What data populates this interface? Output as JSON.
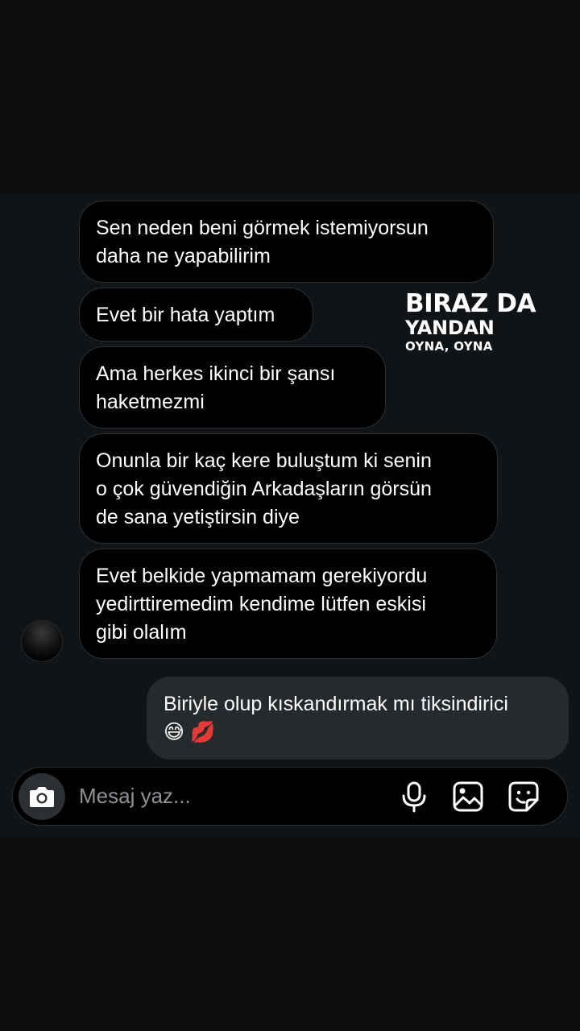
{
  "overlay": {
    "line1": "BIRAZ DA",
    "line2": "YANDAN",
    "line3": "OYNA, OYNA"
  },
  "messages": [
    {
      "side": "received",
      "text": "Sen neden beni görmek istemiyorsun\ndaha ne yapabilirim"
    },
    {
      "side": "received",
      "text": "Evet bir hata yaptım"
    },
    {
      "side": "received",
      "text": "Ama herkes ikinci bir şansı\nhaketmezmi"
    },
    {
      "side": "received",
      "text": "Onunla bir kaç kere buluştum ki senin\no çok güvendiğin Arkadaşların görsün\nde sana yetiştirsin diye"
    },
    {
      "side": "received",
      "text": "Evet belkide yapmamam gerekiyordu\nyedirttiremedim kendime lütfen eskisi\ngibi olalım"
    },
    {
      "side": "sent",
      "text": "Biriyle olup kıskandırmak mı tiksindirici\n😅 💋"
    }
  ],
  "composer": {
    "placeholder": "Mesaj yaz...",
    "icons": [
      "camera-icon",
      "microphone-icon",
      "gallery-icon",
      "sticker-icon"
    ]
  },
  "colors": {
    "chat_background": "#101416",
    "received_bubble": "#000000",
    "sent_bubble": "#262a2d",
    "text": "#ffffff"
  }
}
